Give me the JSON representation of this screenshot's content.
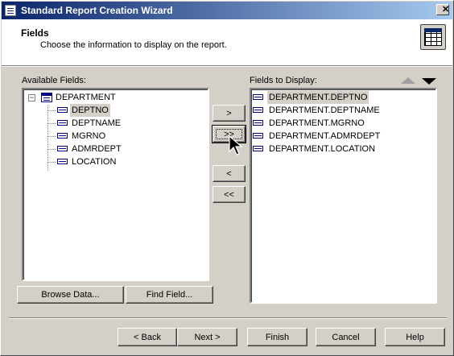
{
  "window": {
    "title": "Standard Report Creation Wizard",
    "close_label": "✕"
  },
  "header": {
    "title": "Fields",
    "subtitle": "Choose the information to display on the report."
  },
  "available": {
    "label": "Available Fields:",
    "table": {
      "name": "DEPARTMENT",
      "expander": "−"
    },
    "fields": [
      "DEPTNO",
      "DEPTNAME",
      "MGRNO",
      "ADMRDEPT",
      "LOCATION"
    ],
    "selected_field": "DEPTNO"
  },
  "display": {
    "label": "Fields to Display:",
    "fields": [
      "DEPARTMENT.DEPTNO",
      "DEPARTMENT.DEPTNAME",
      "DEPARTMENT.MGRNO",
      "DEPARTMENT.ADMRDEPT",
      "DEPARTMENT.LOCATION"
    ],
    "selected_field": "DEPARTMENT.DEPTNO"
  },
  "move_buttons": {
    "add": ">",
    "add_all": ">>",
    "remove": "<",
    "remove_all": "<<"
  },
  "list_buttons": {
    "browse": "Browse Data...",
    "find": "Find Field..."
  },
  "footer": {
    "back": "< Back",
    "next": "Next >",
    "finish": "Finish",
    "cancel": "Cancel",
    "help": "Help"
  },
  "colors": {
    "titlebar_start": "#0a246a",
    "titlebar_end": "#a6caf0",
    "dialog_bg": "#d4d0c8",
    "selection_bg": "#d4d0c8",
    "up_arrow_disabled": "#a0a0a0",
    "down_arrow": "#000000"
  }
}
